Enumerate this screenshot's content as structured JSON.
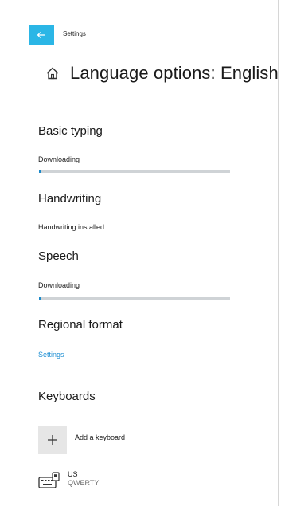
{
  "window": {
    "title": "Settings",
    "accent": "#2bb6e6"
  },
  "header": {
    "title": "Language options: English",
    "icon": "home-icon"
  },
  "sections": {
    "basic_typing": {
      "heading": "Basic typing",
      "status": "Downloading",
      "progress": 0.01
    },
    "handwriting": {
      "heading": "Handwriting",
      "status": "Handwriting installed"
    },
    "speech": {
      "heading": "Speech",
      "status": "Downloading",
      "progress": 0.01
    },
    "regional_format": {
      "heading": "Regional format",
      "link": "Settings"
    },
    "keyboards": {
      "heading": "Keyboards",
      "add_label": "Add a keyboard",
      "items": [
        {
          "name": "US",
          "layout": "QWERTY",
          "icon": "keyboard-icon"
        }
      ]
    }
  },
  "colors": {
    "progress_fill": "#1b89c9",
    "progress_track": "#cfd3d6",
    "link": "#1e8fd3"
  }
}
